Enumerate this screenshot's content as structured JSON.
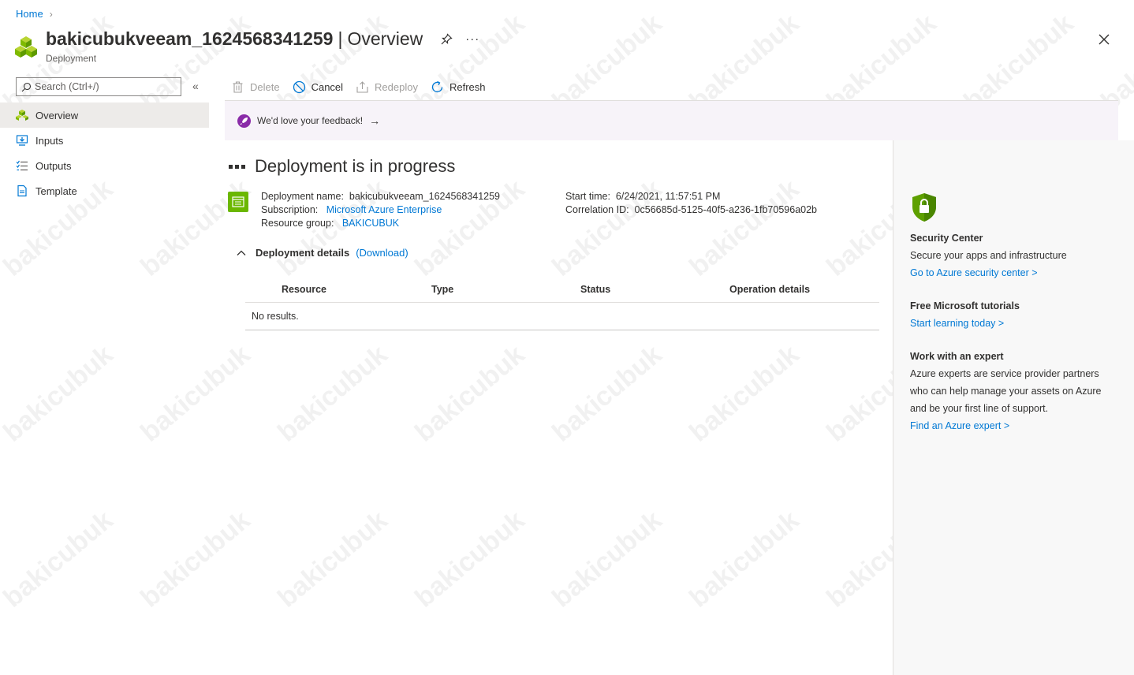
{
  "breadcrumb": {
    "home": "Home"
  },
  "header": {
    "title": "bakicubukveeam_1624568341259",
    "separator": "|",
    "page": "Overview",
    "subtitle": "Deployment",
    "more": "···"
  },
  "search": {
    "placeholder": "Search (Ctrl+/)"
  },
  "nav": {
    "collapse": "«",
    "items": [
      {
        "label": "Overview",
        "icon": "deployment-icon"
      },
      {
        "label": "Inputs",
        "icon": "inputs-icon"
      },
      {
        "label": "Outputs",
        "icon": "outputs-icon"
      },
      {
        "label": "Template",
        "icon": "template-icon"
      }
    ]
  },
  "toolbar": {
    "delete": "Delete",
    "cancel": "Cancel",
    "redeploy": "Redeploy",
    "refresh": "Refresh"
  },
  "feedback": {
    "text": "We'd love your feedback!",
    "arrow": "→"
  },
  "main": {
    "title": "Deployment is in progress",
    "deployment_name_label": "Deployment name:",
    "deployment_name": "bakicubukveeam_1624568341259",
    "subscription_label": "Subscription:",
    "subscription": "Microsoft Azure Enterprise",
    "resource_group_label": "Resource group:",
    "resource_group": "BAKICUBUK",
    "start_time_label": "Start time:",
    "start_time": "6/24/2021, 11:57:51 PM",
    "correlation_label": "Correlation ID:",
    "correlation_id": "0c56685d-5125-40f5-a236-1fb70596a02b",
    "details_label": "Deployment details",
    "download": "(Download)"
  },
  "table": {
    "columns": [
      "Resource",
      "Type",
      "Status",
      "Operation details"
    ],
    "empty": "No results."
  },
  "right_panel": {
    "security_title": "Security Center",
    "security_desc": "Secure your apps and infrastructure",
    "security_link": "Go to Azure security center >",
    "tutorials_title": "Free Microsoft tutorials",
    "tutorials_link": "Start learning today >",
    "expert_title": "Work with an expert",
    "expert_desc": "Azure experts are service provider partners who can help manage your assets on Azure and be your first line of support.",
    "expert_link": "Find an Azure expert >"
  },
  "watermark": "bakicubuk",
  "colors": {
    "accent": "#0078d4",
    "feedback_bg": "#f7f3f9",
    "nav_active": "#edebe9",
    "deploy_green": "#6bb700"
  }
}
